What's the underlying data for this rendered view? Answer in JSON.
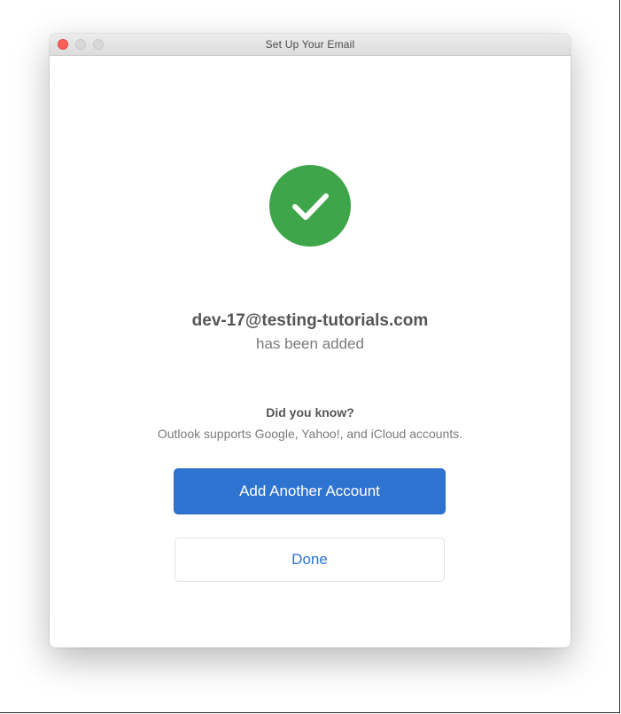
{
  "window": {
    "title": "Set Up Your Email"
  },
  "success": {
    "icon": "checkmark-icon",
    "icon_color": "#3fa54a",
    "email": "dev-17@testing-tutorials.com",
    "added_text": "has been added"
  },
  "tip": {
    "heading": "Did you know?",
    "text": "Outlook supports Google, Yahoo!, and iCloud accounts."
  },
  "actions": {
    "add_another_label": "Add Another Account",
    "done_label": "Done"
  },
  "colors": {
    "accent": "#2f73d1",
    "success": "#3fa54a",
    "close_button": "#fc5f57"
  }
}
